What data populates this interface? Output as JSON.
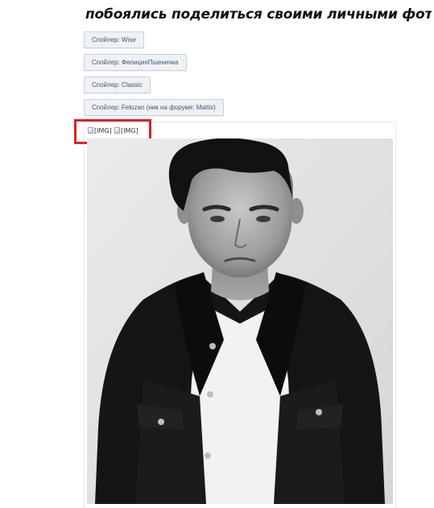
{
  "heading": "побоялись поделиться своими личными фото:",
  "spoilers": [
    {
      "label": "Спойлер: Wise"
    },
    {
      "label": "Спойлер: ФелицияПшеничка"
    },
    {
      "label": "Спойлер: Classic"
    },
    {
      "label": "Спойлер: Felozan (ник на форуме: Mattix)"
    }
  ],
  "images": [
    {
      "alt": "[IMG]"
    },
    {
      "alt": "[IMG]"
    }
  ],
  "highlight_color": "#e01f26"
}
